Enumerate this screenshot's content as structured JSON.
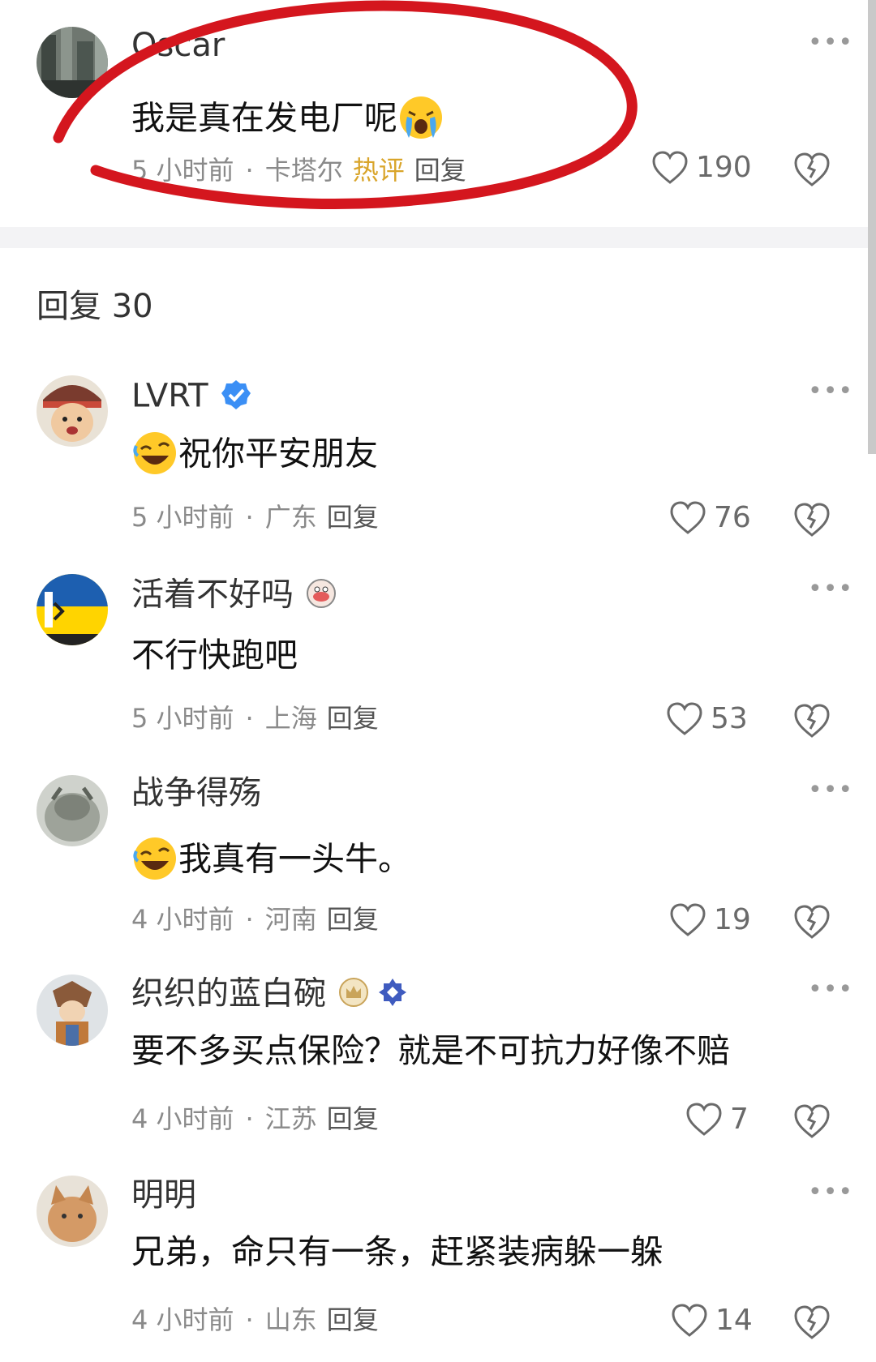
{
  "top_comment": {
    "username": "Oscar",
    "text": "我是真在发电厂呢",
    "emoji": "crying-face-icon",
    "time": "5 小时前",
    "location": "卡塔尔",
    "hot_label": "热评",
    "reply_label": "回复",
    "likes": "190"
  },
  "replies_header": {
    "label": "回复",
    "count": "30"
  },
  "replies": [
    {
      "username": "LVRT",
      "badge": "verified-icon",
      "emoji": "rofl-face-icon",
      "text": "祝你平安朋友",
      "time": "5 小时前",
      "location": "广东",
      "reply_label": "回复",
      "likes": "76"
    },
    {
      "username": "活着不好吗",
      "badge": "sticker-icon",
      "text": "不行快跑吧",
      "time": "5 小时前",
      "location": "上海",
      "reply_label": "回复",
      "likes": "53"
    },
    {
      "username": "战争得殇",
      "emoji": "rofl-face-icon",
      "text": "我真有一头牛。",
      "time": "4 小时前",
      "location": "河南",
      "reply_label": "回复",
      "likes": "19"
    },
    {
      "username": "织织的蓝白碗",
      "badge": "crown-icon",
      "text": "要不多买点保险？就是不可抗力好像不赔",
      "time": "4 小时前",
      "location": "江苏",
      "reply_label": "回复",
      "likes": "7"
    },
    {
      "username": "明明",
      "text": "兄弟，命只有一条，赶紧装病躲一躲",
      "time": "4 小时前",
      "location": "山东",
      "reply_label": "回复",
      "likes": "14"
    }
  ],
  "colors": {
    "accent_red": "#d4161e",
    "hot_gold": "#d9a52b",
    "verified_blue": "#3b8ff5",
    "muted": "#8a8a8a"
  }
}
